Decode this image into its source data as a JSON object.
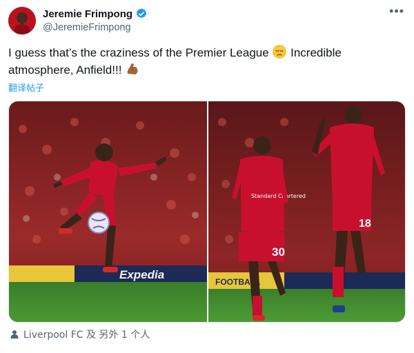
{
  "author": {
    "display_name": "Jeremie Frimpong",
    "handle": "@JeremieFrimpong",
    "verified": true,
    "avatar_icon": "profile-avatar"
  },
  "menu": {
    "more_label": "•••"
  },
  "tweet": {
    "text_part1": "I guess that’s the craziness of the Premier League ",
    "emoji1": "😔",
    "text_part2": " Incredible atmosphere, Anfield!!! ",
    "emoji2": "💪",
    "translate_label": "翻译帖子"
  },
  "media": {
    "photo_count": 2,
    "left_photo": {
      "ad_board_text": "Expedia",
      "ball_icon": "football-icon"
    },
    "right_photo": {
      "front_player_number": "30",
      "back_player_number": "18",
      "ad_board_text": "FOOTBALL",
      "sponsor_text": "Standard Chartered"
    }
  },
  "tags": {
    "label": "Liverpool FC 及 另外 1 个人",
    "icon": "person-icon"
  },
  "colors": {
    "accent": "#1d9bf0",
    "kit_red": "#c8102e",
    "pitch_green": "#3f8a2e",
    "muted": "#536471"
  }
}
